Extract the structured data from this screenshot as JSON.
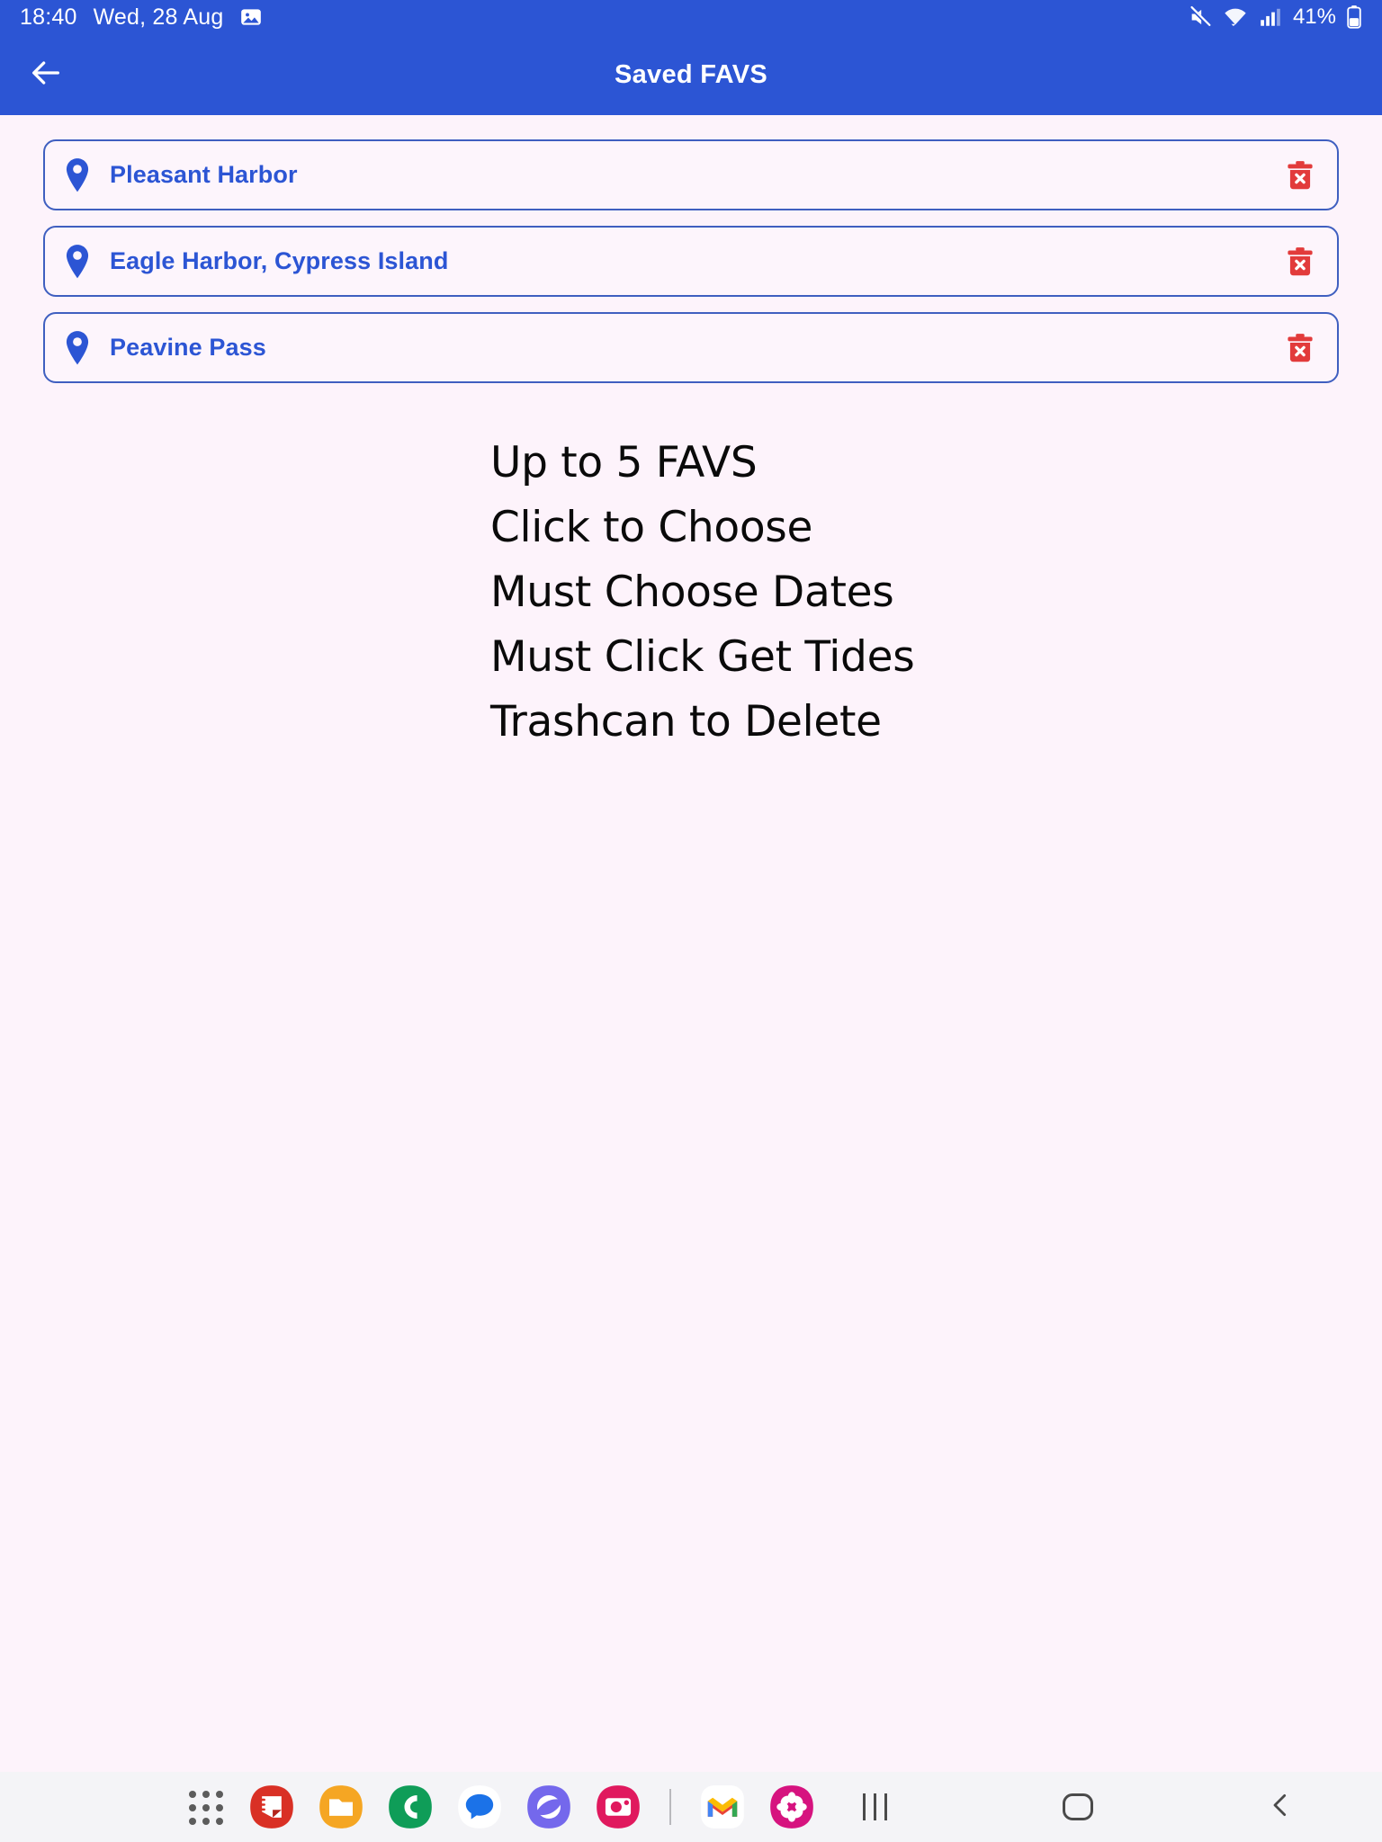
{
  "status_bar": {
    "time": "18:40",
    "date": "Wed, 28 Aug",
    "screenshot_icon": "image-icon",
    "mute_icon": "mute-icon",
    "wifi_icon": "wifi-icon",
    "signal_icon": "cellular-signal-icon",
    "battery_percent": "41%",
    "battery_icon": "battery-icon",
    "background_color": "#2c55d4",
    "text_color": "#ffffff"
  },
  "app_bar": {
    "back_icon": "arrow-left-icon",
    "title": "Saved FAVS",
    "background_color": "#2c55d4",
    "title_color": "#ffffff"
  },
  "favorites": {
    "pin_icon": "map-pin-icon",
    "delete_icon": "trash-delete-icon",
    "accent_color": "#2c55d4",
    "border_color": "#3f5fc0",
    "delete_color": "#e23b3b",
    "items": [
      {
        "name": "Pleasant Harbor"
      },
      {
        "name": "Eagle Harbor, Cypress Island"
      },
      {
        "name": "Peavine Pass"
      }
    ]
  },
  "instructions": {
    "lines": [
      "Up to 5 FAVS",
      "Click to Choose",
      "Must Choose Dates",
      "Must Click Get Tides",
      "Trashcan to Delete"
    ]
  },
  "taskbar": {
    "apps_button": "apps-grid-icon",
    "apps": [
      {
        "icon": "samsung-notes-icon"
      },
      {
        "icon": "my-files-icon"
      },
      {
        "icon": "phone-icon"
      },
      {
        "icon": "messages-icon"
      },
      {
        "icon": "samsung-internet-icon"
      },
      {
        "icon": "camera-icon"
      },
      {
        "icon": "gmail-icon"
      },
      {
        "icon": "gallery-icon"
      }
    ],
    "nav": [
      {
        "icon": "recents-icon"
      },
      {
        "icon": "home-icon"
      },
      {
        "icon": "back-icon"
      }
    ],
    "background_color": "#f4f4f7"
  },
  "page": {
    "background_color": "#fdf3fb"
  }
}
